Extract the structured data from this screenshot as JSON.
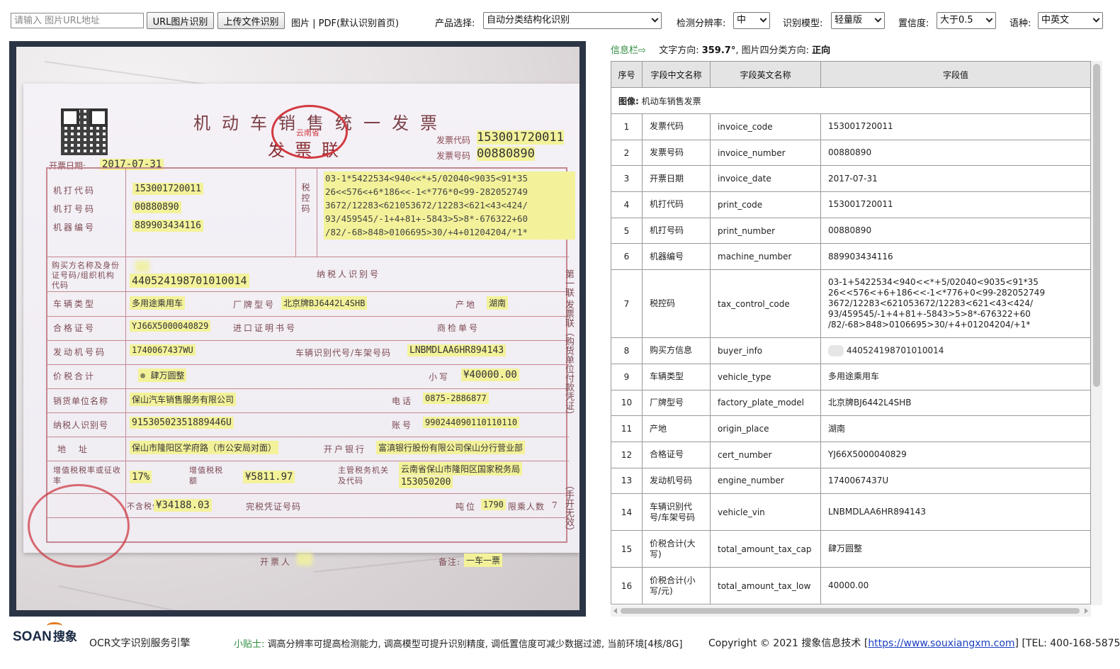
{
  "toolbar": {
    "url_placeholder": "请输入 图片URL地址",
    "url_button": "URL图片识别",
    "upload_button": "上传文件识别",
    "hint": "图片 | PDF(默认识别首页)",
    "product_label": "产品选择:",
    "product_value": "自动分类结构化识别",
    "resolution_label": "检测分辨率:",
    "resolution_value": "中",
    "model_label": "识别模型:",
    "model_value": "轻量版",
    "confidence_label": "置信度:",
    "confidence_value": "大于0.5",
    "language_label": "语种:",
    "language_value": "中英文"
  },
  "invoice_image": {
    "title": "机动车销售统一发票",
    "subtitle": "发票联",
    "seal_text": "云南省",
    "invoice_code_label": "发票代码",
    "invoice_code": "153001720011",
    "invoice_number_label": "发票号码",
    "invoice_number": "00880890",
    "date_label": "开票日期:",
    "date": "2017-07-31",
    "print_code_label": "机打代码",
    "print_code": "153001720011",
    "print_number_label": "机打号码",
    "print_number": "00880890",
    "machine_label": "机器编号",
    "machine_number": "889903434116",
    "tax_label": "税控码",
    "tax_lines": [
      "03-1*5422534<940<<*+5/02040<9035<91*35",
      "26<<576<+6*186<<-1<*776*0<99-282052749",
      "3672/12283<621053672/12283<621<43<424/",
      "93/459545/-1+4+81+-5843>5>8*-676322+60",
      "/82/-68>848>0106695>30/+4+01204204/*1*"
    ],
    "buyer_label": "购买方名称及身份证号码/组织机构代码",
    "buyer_id": "440524198701010014",
    "taxpayer_label": "纳税人识别号",
    "vehicle_type_label": "车辆类型",
    "vehicle_type": "多用途乘用车",
    "plate_label": "厂牌型号",
    "plate_model": "北京牌BJ6442L4SHB",
    "origin_label": "产地",
    "origin": "湖南",
    "cert_label": "合格证号",
    "cert_number": "YJ66X5000040829",
    "import_label": "进口证明书号",
    "inspection_label": "商检单号",
    "engine_label": "发动机号码",
    "engine_number": "1740067437WU",
    "vin_label": "车辆识别代号/车架号码",
    "vin": "LNBMDLAA6HR894143",
    "total_label": "价税合计",
    "total_cap": "⊗ 肆万圆整",
    "small_label": "小写",
    "total_low": "¥40000.00",
    "seller_label": "销货单位名称",
    "seller": "保山汽车销售服务有限公司",
    "phone_label": "电话",
    "phone": "0875-2886877",
    "seller_tax_label": "纳税人识别号",
    "seller_tax": "91530502351889446U",
    "account_label": "账号",
    "account": "990244090110110110",
    "address_label": "地址",
    "address": "保山市隆阳区学府路（市公安局对面）",
    "bank_label": "开户银行",
    "bank": "富滇银行股份有限公司保山分行营业部",
    "vat_rate_label": "增值税税率或征收率",
    "vat_rate": "17%",
    "vat_amount_label": "增值税税额",
    "vat_amount": "¥5811.97",
    "authority_label": "主管税务机关及代码",
    "authority": "云南省保山市隆阳区国家税务局",
    "authority_code": "153050200",
    "no_tax_label": "不含税价",
    "no_tax_value": "¥34188.03",
    "tax_cert_label": "完税凭证号码",
    "tonnage_label": "吨位",
    "tonnage": "1790",
    "seats_label": "限乘人数",
    "seats": "7",
    "issuer_label": "开票人",
    "remark_label": "备注:",
    "remark": "一车一票",
    "side_text_1": "第一联 发票联（购货单位付款凭证）",
    "side_text_2": "（手开无效）"
  },
  "info": {
    "link": "信息栏⇨",
    "direction_label": "文字方向:",
    "direction_value": "359.7°",
    "classify_label": ", 图片四分类方向:",
    "classify_value": "正向"
  },
  "table": {
    "headers": [
      "序号",
      "字段中文名称",
      "字段英文名称",
      "字段值"
    ],
    "image_label": "图像:",
    "image_value": "机动车销售发票",
    "rows": [
      {
        "no": "1",
        "cn": "发票代码",
        "en": "invoice_code",
        "val": "153001720011"
      },
      {
        "no": "2",
        "cn": "发票号码",
        "en": "invoice_number",
        "val": "00880890"
      },
      {
        "no": "3",
        "cn": "开票日期",
        "en": "invoice_date",
        "val": "2017-07-31"
      },
      {
        "no": "4",
        "cn": "机打代码",
        "en": "print_code",
        "val": "153001720011"
      },
      {
        "no": "5",
        "cn": "机打号码",
        "en": "print_number",
        "val": "00880890"
      },
      {
        "no": "6",
        "cn": "机器编号",
        "en": "machine_number",
        "val": "889903434116"
      },
      {
        "no": "7",
        "cn": "税控码",
        "en": "tax_control_code",
        "val": "03-1+5422534<940<<*+5/02040<9035<91*35\n26<<576<+6+186<<-1<*776+0<99-282052749\n3672/12283<621053672/12283<621<43<424/\n93/459545/-1+4+81+-5843>5>8*-676322+60\n/82/-68>848>0106695>30/+4+01204204/+1*"
      },
      {
        "no": "8",
        "cn": "购买方信息",
        "en": "buyer_info",
        "val": "440524198701010014"
      },
      {
        "no": "9",
        "cn": "车辆类型",
        "en": "vehicle_type",
        "val": "多用途乘用车"
      },
      {
        "no": "10",
        "cn": "厂牌型号",
        "en": "factory_plate_model",
        "val": "北京牌BJ6442L4SHB"
      },
      {
        "no": "11",
        "cn": "产地",
        "en": "origin_place",
        "val": "湖南"
      },
      {
        "no": "12",
        "cn": "合格证号",
        "en": "cert_number",
        "val": "YJ66X5000040829"
      },
      {
        "no": "13",
        "cn": "发动机号码",
        "en": "engine_number",
        "val": "1740067437U"
      },
      {
        "no": "14",
        "cn": "车辆识别代\n号/车架号码",
        "en": "vehicle_vin",
        "val": "LNBMDLAA6HR894143"
      },
      {
        "no": "15",
        "cn": "价税合计(大\n写)",
        "en": "total_amount_tax_cap",
        "val": "肆万圆整"
      },
      {
        "no": "16",
        "cn": "价税合计(小\n写/元)",
        "en": "total_amount_tax_low",
        "val": "40000.00"
      }
    ]
  },
  "footer": {
    "logo_word": "SOAN",
    "logo_cn": "搜象",
    "desc": "OCR文字识别服务引擎",
    "tip_label": "小贴士:",
    "tip_text": " 调高分辨率可提高检测能力, 调高模型可提升识别精度, 调低置信度可减少数据过滤, 当前环境[4核/8G]",
    "copyright_prefix": "Copyright © 2021 搜象信息技术 [",
    "url": "https://www.souxiangxm.com",
    "copyright_suffix": "] [TEL: 400-168-5875]"
  }
}
